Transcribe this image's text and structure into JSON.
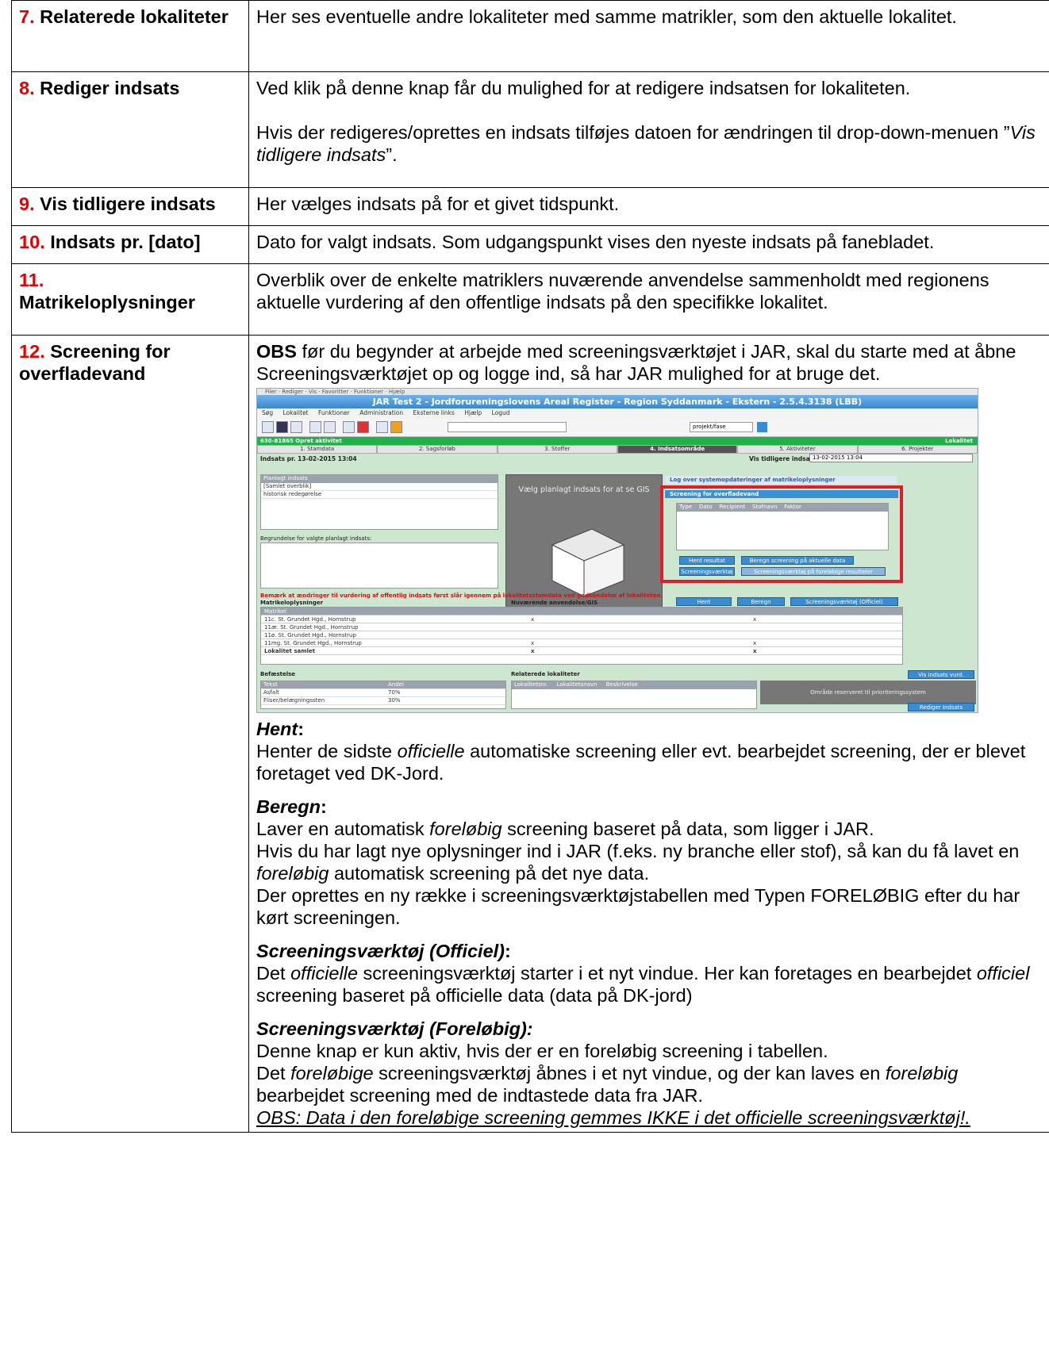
{
  "rows": [
    {
      "num": "7.",
      "label": "Relaterede lokaliteter",
      "text": "Her ses eventuelle andre lokaliteter med samme matrikler, som den aktuelle lokalitet."
    },
    {
      "num": "8.",
      "label": "Rediger indsats",
      "text1": "Ved klik på denne knap får du mulighed for at redigere indsatsen for lokaliteten.",
      "text2_a": "Hvis der redigeres/oprettes en indsats tilføjes datoen for ændringen til drop-down-menuen ”",
      "text2_em": "Vis tidligere indsats",
      "text2_b": "”."
    },
    {
      "num": "9.",
      "label": "Vis tidligere indsats",
      "text": "Her vælges indsats på for et givet tidspunkt."
    },
    {
      "num": "10.",
      "label": "Indsats pr. [dato]",
      "text": "Dato for valgt indsats. Som udgangspunkt vises den nyeste indsats på fanebladet."
    },
    {
      "num": "11.",
      "label": "Matrikeloplysninger",
      "text": "Overblik over de enkelte matriklers nuværende anvendelse sammenholdt med regionens aktuelle vurdering af den offentlige indsats på den specifikke lokalitet."
    },
    {
      "num": "12.",
      "label": "Screening for overfladevand",
      "obs_bold": "OBS",
      "obs_text": " før du begynder at arbejde med screeningsværktøjet i JAR, skal du starte med at åbne Screeningsværktøjet op og logge ind, så har JAR mulighed for at bruge det.",
      "hent_h": "Hent",
      "hent_a": "Henter de sidste ",
      "hent_em": "officielle",
      "hent_b": " automatiske screening eller evt. bearbejdet screening, der er blevet foretaget ved DK-Jord.",
      "beregn_h": "Beregn",
      "beregn_1a": "Laver en automatisk ",
      "beregn_1em": "foreløbig",
      "beregn_1b": " screening baseret på data, som ligger i JAR.",
      "beregn_2a": "Hvis du har lagt nye oplysninger ind i JAR (f.eks. ny branche eller stof), så kan du få lavet en ",
      "beregn_2em": "foreløbig",
      "beregn_2b": " automatisk screening på det nye data.",
      "beregn_3": "Der oprettes en ny række i screeningsværktøjstabellen med Typen FORELØBIG efter du har kørt screeningen.",
      "off_h": "Screeningsværktøj (Officiel)",
      "off_a": "Det ",
      "off_em1": "officielle",
      "off_b": " screeningsværktøj starter i et nyt vindue. Her kan foretages en bearbejdet ",
      "off_em2": "officiel",
      "off_c": " screening baseret på officielle data (data på DK-jord)",
      "for_h": "Screeningsværktøj (Foreløbig):",
      "for_1": "Denne knap er kun aktiv, hvis der er en foreløbig screening i tabellen.",
      "for_2a": "Det ",
      "for_2em": "foreløbige",
      "for_2b": " screeningsværktøj åbnes i et nyt vindue, og der kan laves en ",
      "for_3em": "foreløbig",
      "for_3b": " bearbejdet screening med de indtastede data fra JAR.",
      "for_obs": "OBS: Data i den foreløbige screening gemmes IKKE i det officielle screeningsværktøj!."
    }
  ],
  "shot": {
    "title": "JAR Test 2 - Jordforureningslovens Areal Register - Region Syddanmark - Ekstern - 2.5.4.3138 (LBB)",
    "menu": [
      "Søg",
      "Lokalitet",
      "Funktioner",
      "Administration",
      "Eksterne links",
      "Hjælp",
      "Logud"
    ],
    "project": "projekt/fase",
    "green_left": "630-81865 Opret aktivitet",
    "green_right": "Lokalitet",
    "tabs": [
      "1. Stamdata",
      "2. Sagsforløb",
      "3. Stoffer",
      "4. Indsatsområde",
      "5. Aktiviteter",
      "6. Projekter"
    ],
    "active_tab": "4. Indsatsområde",
    "inds_date": "Indsats pr. 13-02-2015 13:04",
    "vis_label": "Vis tidligere indsats",
    "vis_value": "13-02-2015 13:04",
    "planlagt_head": "Planlagt indsats",
    "planlagt_items": [
      "[Samlet overblik]",
      "historisk redegørelse"
    ],
    "begrundelse": "Begrundelse for valgte planlagt indsats:",
    "gis": "Vælg planlagt indsats for at se GIS",
    "log": "Log over systemopdateringer af matrikeloplysninger",
    "screening": "Screening for overfladevand",
    "screen_cols": [
      "Type",
      "Dato",
      "Recipient",
      "Stofnavn",
      "Faktor"
    ],
    "btn_hent": "Hent resultat",
    "btn_beregn": "Beregn screening på aktuelle data",
    "btn_screen": "Screeningsværktøj",
    "btn_screen_for": "Screeningsværktøj på foreløbige resultater",
    "warn": "Bemærk at ændringer til vurdering af offentlig indsats først slår igennem på lokalitetsstamdata ved godkendelse af lokaliteten.",
    "matr_title": "Matrikeloplysninger",
    "nuv_title": "Nuværende anvendelse/GIS",
    "btn_hent2": "Hent",
    "btn_beregn2": "Beregn",
    "btn_off": "Screeningsværktøj (Officiel)",
    "matr_cols": "Matrikel",
    "matr_rows": [
      "11c. St. Grundet Hgd., Hornstrup",
      "11æ. St. Grundet Hgd., Hornstrup",
      "11ø. St. Grundet Hgd., Hornstrup",
      "11mg. St. Grundet Hgd., Hornstrup",
      "Lokalitet samlet"
    ],
    "befaestelse": "Befæstelse",
    "bef_rows": [
      [
        "Tekst",
        "Andel"
      ],
      [
        "Asfalt",
        "70%"
      ],
      [
        "Fliser/belægningssten",
        "30%"
      ]
    ],
    "relaterede": "Relaterede lokaliteter",
    "rel_cols": [
      "Lokalitetsnr.",
      "Lokalitetsnavn",
      "Beskrivelse"
    ],
    "btn_vis": "Vis indsats vurd.",
    "reserveret": "Område reserveret til prioriteringssystem",
    "btn_rediger": "Rediger Indsats"
  }
}
